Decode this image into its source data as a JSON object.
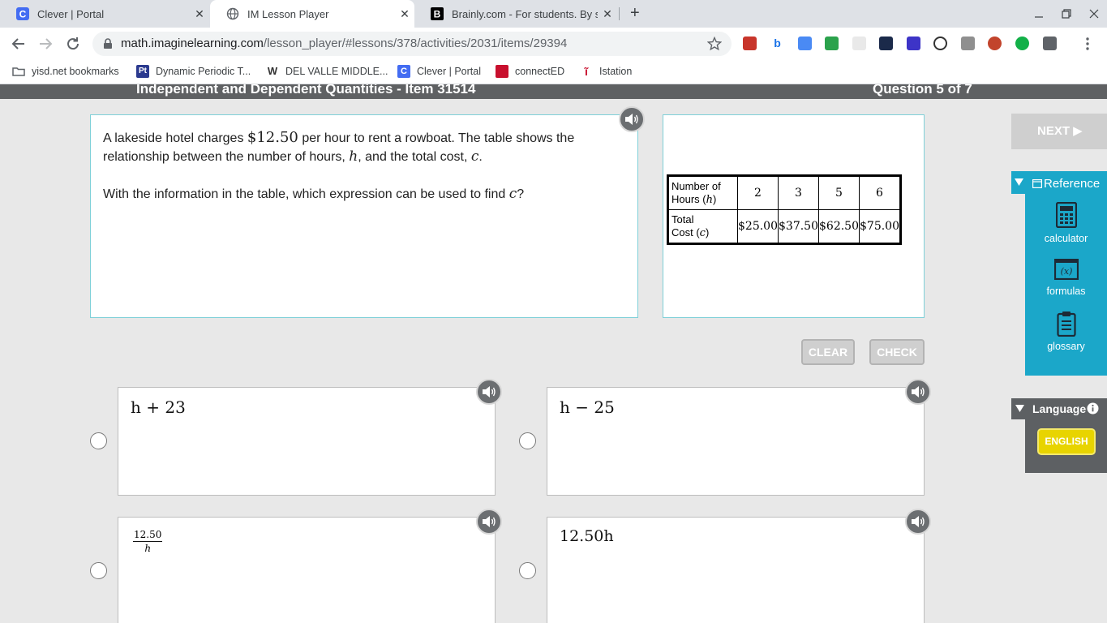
{
  "browser": {
    "tabs": [
      {
        "title": "Clever | Portal",
        "close": "✕"
      },
      {
        "title": "IM Lesson Player",
        "close": "✕"
      },
      {
        "title": "Brainly.com - For students. By st",
        "close": "✕"
      }
    ],
    "new_tab": "+",
    "url_host": "math.imaginelearning.com",
    "url_path": "/lesson_player/#lessons/378/activities/2031/items/29394",
    "bookmarks": [
      "yisd.net bookmarks",
      "Dynamic Periodic T...",
      "DEL VALLE MIDDLE...",
      "Clever | Portal",
      "connectED",
      "Istation"
    ],
    "colors": {
      "tabbar": "#dee1e6",
      "omnibox": "#f1f3f4"
    }
  },
  "lesson": {
    "title": "Independent and Dependent Quantities - Item 31514",
    "progress": "Question 5 of 7"
  },
  "question": {
    "p1_a": "A lakeside hotel charges ",
    "price": "$12.50",
    "p1_b": " per hour to rent a rowboat. The table shows the relationship between the number of hours, ",
    "var_h": "h",
    "p1_c": ", and the total cost, ",
    "var_c": "c",
    "p1_d": ".",
    "p2_a": "With the information in the table, which expression can be used to find ",
    "p2_b": "?"
  },
  "table": {
    "row1_label_a": "Number of",
    "row1_label_b": "Hours (",
    "row1_var": "h",
    "row1_close": ")",
    "row2_label_a": "Total",
    "row2_label_b": "Cost (",
    "row2_var": "c",
    "row2_close": ")",
    "hours": [
      "2",
      "3",
      "5",
      "6"
    ],
    "costs": [
      "$25.00",
      "$37.50",
      "$62.50",
      "$75.00"
    ]
  },
  "actions": {
    "clear": "CLEAR",
    "check": "CHECK",
    "next": "NEXT ▶"
  },
  "choices": [
    {
      "expr": "h + 23"
    },
    {
      "expr": "h − 25"
    },
    {
      "num": "12.50",
      "den": "h"
    },
    {
      "expr": "12.50h"
    }
  ],
  "sidebar": {
    "reference_label": "Reference",
    "tools": [
      "calculator",
      "formulas",
      "glossary"
    ],
    "language_label": "Language",
    "language_button": "ENGLISH",
    "colors": {
      "reference": "#1ba7c9",
      "language": "#5d6063",
      "english_button": "#e8d400"
    }
  }
}
